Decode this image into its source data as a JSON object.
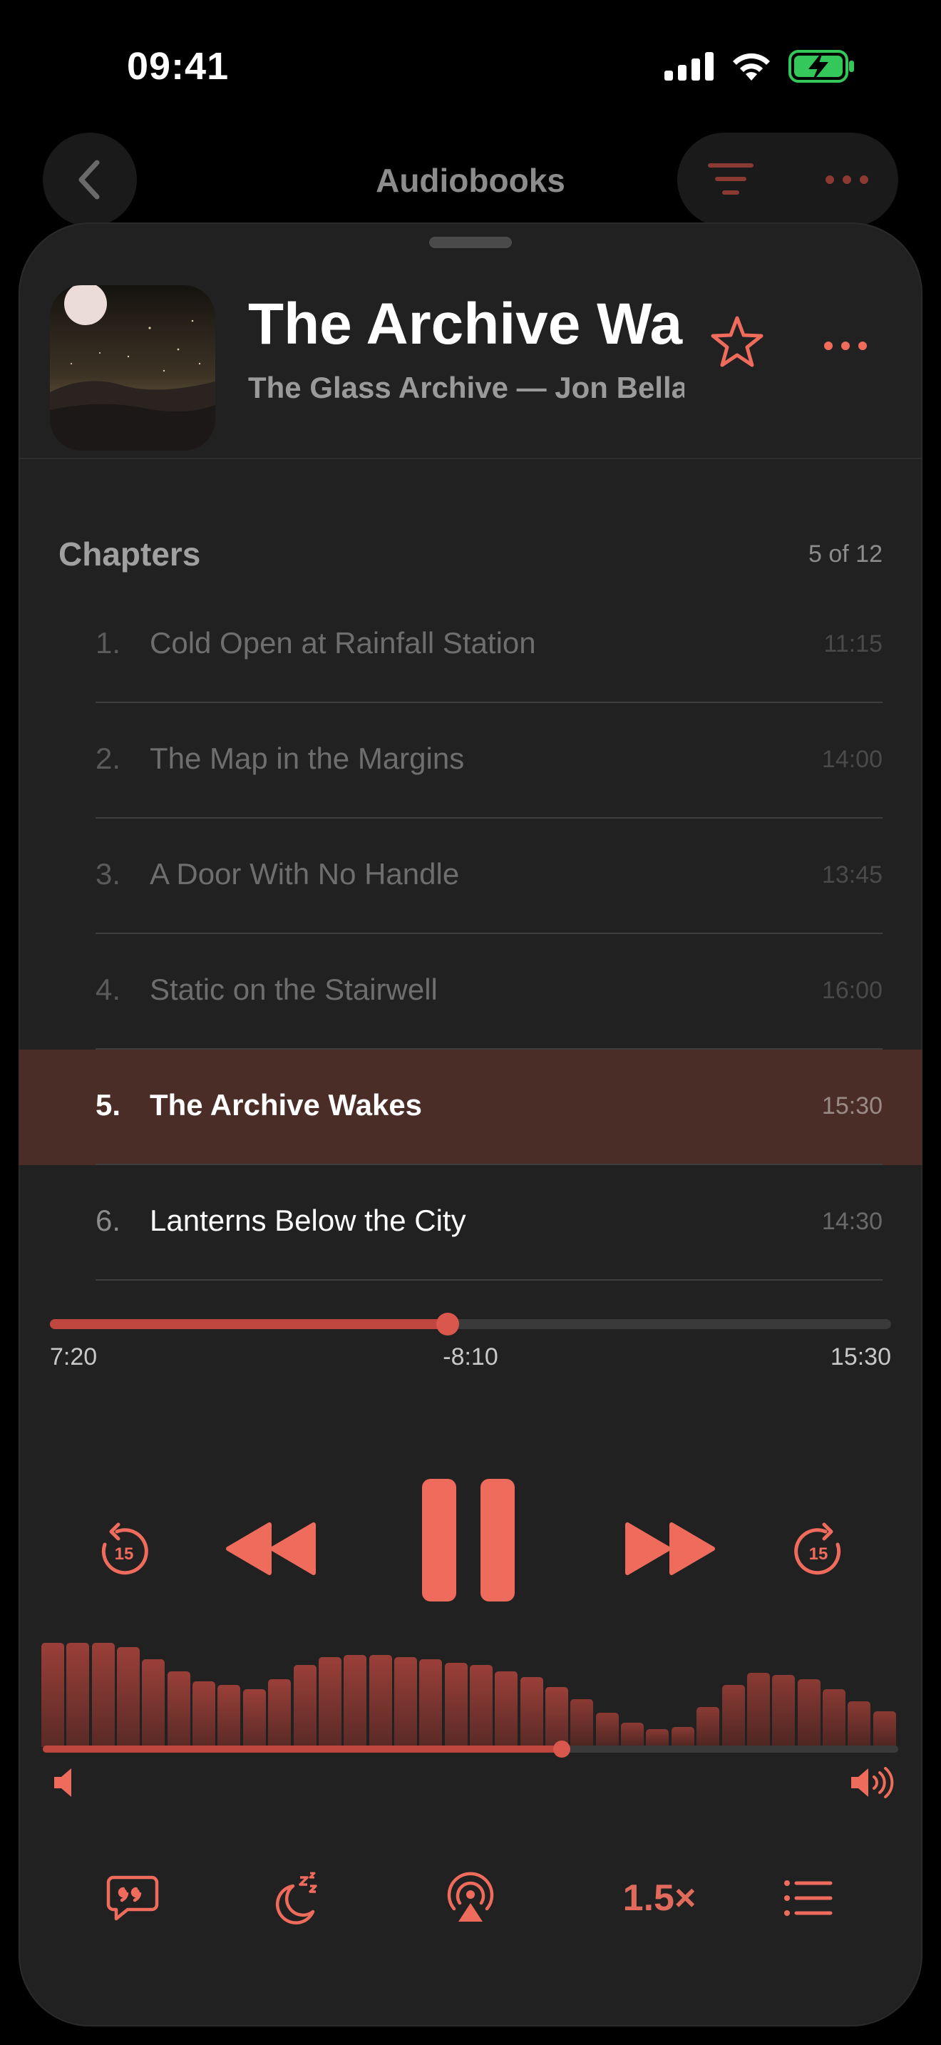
{
  "status_bar": {
    "time": "09:41"
  },
  "nav": {
    "title": "Audiobooks"
  },
  "book": {
    "title": "The Archive Wakes",
    "subtitle": "The Glass Archive — Jon Bellamy"
  },
  "chapters": {
    "heading": "Chapters",
    "count": "5 of 12",
    "items": [
      {
        "num": "1.",
        "name": "Cold Open at Rainfall Station",
        "duration": "11:15"
      },
      {
        "num": "2.",
        "name": "The Map in the Margins",
        "duration": "14:00"
      },
      {
        "num": "3.",
        "name": "A Door With No Handle",
        "duration": "13:45"
      },
      {
        "num": "4.",
        "name": "Static on the Stairwell",
        "duration": "16:00"
      },
      {
        "num": "5.",
        "name": "The Archive Wakes",
        "duration": "15:30"
      },
      {
        "num": "6.",
        "name": "Lanterns Below the City",
        "duration": "14:30"
      }
    ]
  },
  "playback": {
    "elapsed": "7:20",
    "remaining": "-8:10",
    "total": "15:30",
    "progress_fraction": 0.473,
    "skip_back_seconds": "15",
    "skip_forward_seconds": "15",
    "volume_fraction": 0.607
  },
  "waveform_levels": [
    0.52,
    0.52,
    0.52,
    0.5,
    0.44,
    0.38,
    0.33,
    0.31,
    0.29,
    0.34,
    0.41,
    0.45,
    0.46,
    0.46,
    0.45,
    0.44,
    0.42,
    0.41,
    0.38,
    0.35,
    0.3,
    0.24,
    0.17,
    0.12,
    0.09,
    0.1,
    0.2,
    0.31,
    0.37,
    0.36,
    0.34,
    0.29,
    0.23,
    0.18
  ],
  "toolbar": {
    "speed": "1.5×"
  },
  "colors": {
    "accent": "#ef6b5c",
    "sheet": "#212121",
    "active_row": "#4a2d27",
    "battery": "#34c759"
  },
  "icons": [
    "cellular-icon",
    "wifi-icon",
    "battery-charging-icon",
    "chevron-left-icon",
    "filter-icon",
    "ellipsis-icon",
    "star-icon",
    "skip-back-15-icon",
    "rewind-icon",
    "pause-icon",
    "fast-forward-icon",
    "skip-forward-15-icon",
    "volume-low-icon",
    "volume-high-icon",
    "lyrics-quote-icon",
    "sleep-timer-icon",
    "airplay-icon",
    "chapter-list-icon"
  ]
}
